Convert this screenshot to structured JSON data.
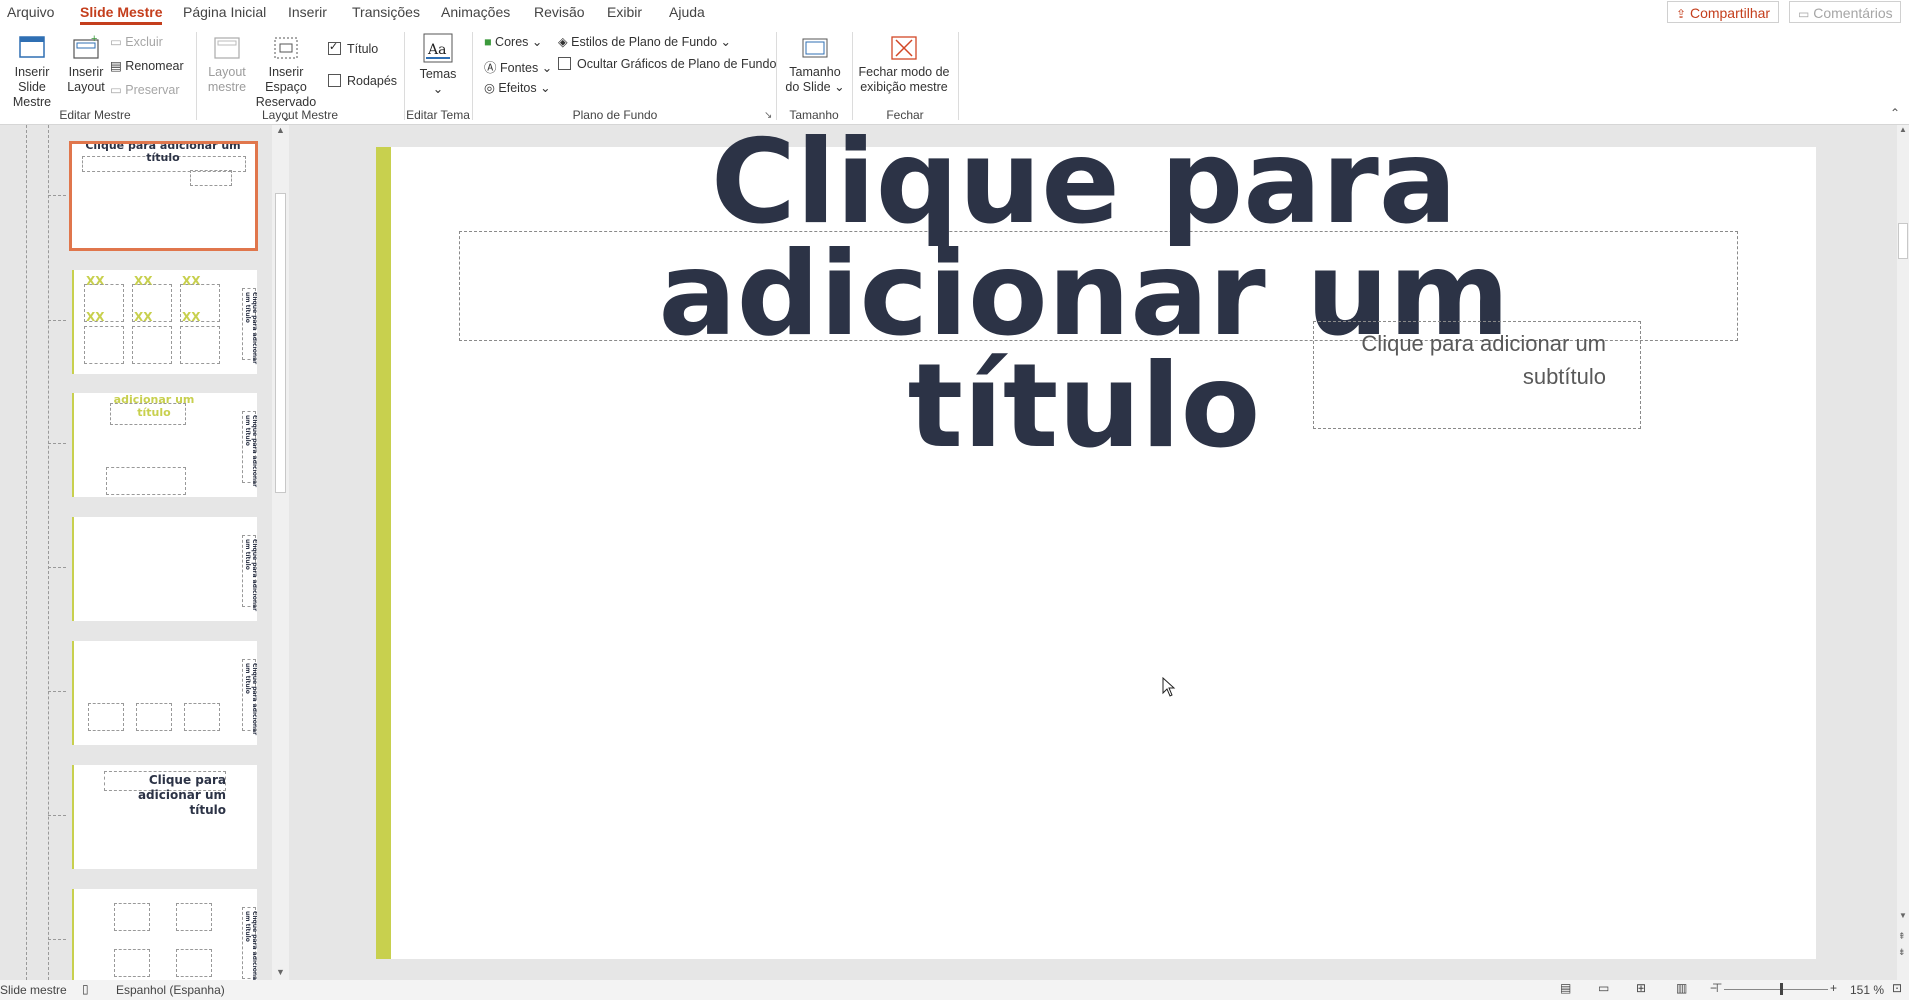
{
  "tabs": [
    "Arquivo",
    "Slide Mestre",
    "Página Inicial",
    "Inserir",
    "Transições",
    "Animações",
    "Revisão",
    "Exibir",
    "Ajuda"
  ],
  "share": {
    "label": "Compartilhar",
    "comments": "Comentários"
  },
  "ribbon": {
    "insert_slide_master": "Inserir Slide Mestre",
    "insert_layout": "Inserir Layout",
    "delete": "Excluir",
    "rename": "Renomear",
    "preserve": "Preservar",
    "master_layout": "Layout mestre",
    "insert_placeholder": "Inserir Espaço Reservado",
    "title_check": "Título",
    "footers_check": "Rodapés",
    "themes": "Temas",
    "colors": "Cores",
    "fonts": "Fontes",
    "effects": "Efeitos",
    "bg_styles": "Estilos de Plano de Fundo",
    "hide_bg": "Ocultar Gráficos de Plano de Fundo",
    "slide_size": "Tamanho do Slide",
    "close_master": "Fechar modo de exibição mestre",
    "groups": {
      "edit_master": "Editar Mestre",
      "master_layout": "Layout Mestre",
      "edit_theme": "Editar Tema",
      "background": "Plano de Fundo",
      "size": "Tamanho",
      "close": "Fechar"
    }
  },
  "thumbnails": {
    "t1_title": "Clique para adicionar um título",
    "t3_title": "adicionar um título",
    "t6_title": "Clique para adicionar um título",
    "xx": "XX",
    "vertical_text": "Clique para adicionar um título"
  },
  "slide": {
    "title": "Clique para adicionar um título",
    "subtitle": "Clique para adicionar um subtítulo"
  },
  "status": {
    "view": "Slide mestre",
    "language": "Espanhol (Espanha)",
    "zoom": "151 %"
  },
  "colors": {
    "accent": "#c43e1c",
    "slide_bar": "#c8d04e",
    "title": "#2c3346"
  }
}
